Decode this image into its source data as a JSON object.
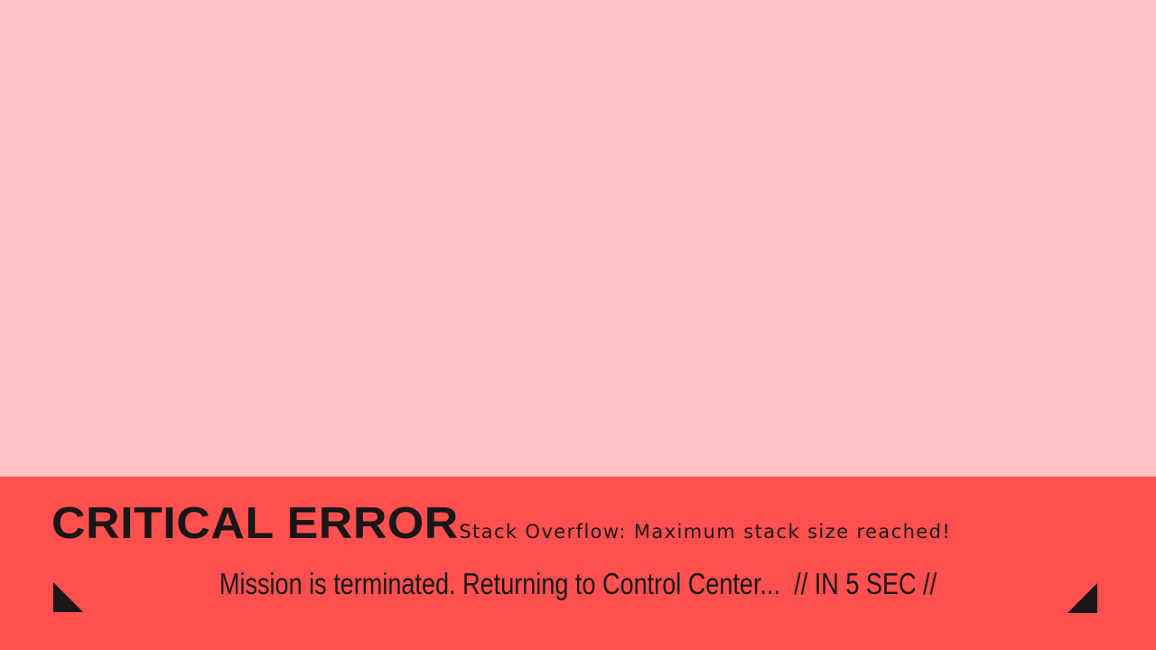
{
  "error_banner": {
    "title": "CRITICAL ERROR",
    "detail": "Stack Overflow: Maximum stack size reached!",
    "message": "Mission is terminated. Returning to Control Center...",
    "countdown": "// IN 5 SEC //"
  },
  "colors": {
    "background": "#ffc4c3",
    "banner": "#ff4f4f",
    "text": "#1a1616"
  },
  "icons": {
    "left_corner": "corner-triangle-icon",
    "right_corner": "corner-triangle-icon"
  }
}
